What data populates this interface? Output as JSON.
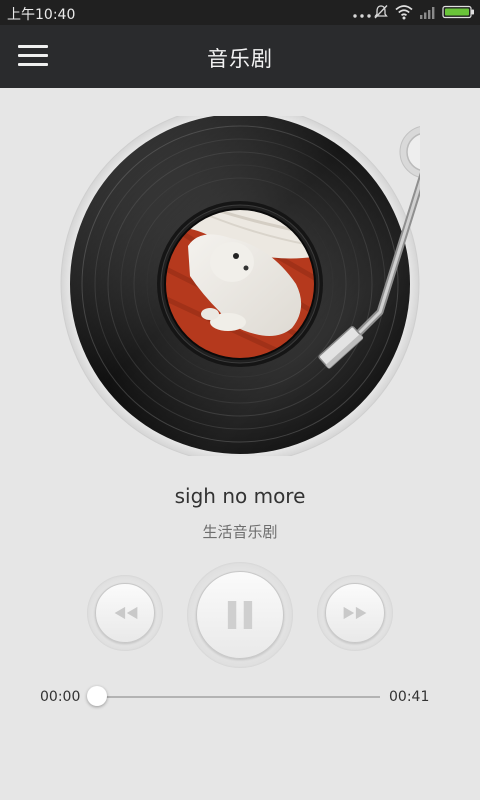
{
  "status_bar": {
    "time": "上午10:40",
    "icons": [
      "more-dots-icon",
      "notifications-muted-icon",
      "wifi-icon",
      "signal-icon",
      "battery-icon"
    ],
    "battery_color": "#6ac43a"
  },
  "app_bar": {
    "title": "音乐剧",
    "menu_icon": "hamburger-menu-icon"
  },
  "player": {
    "song_title": "sigh no more",
    "album": "生活音乐剧",
    "elapsed": "00:00",
    "total": "00:41",
    "progress": 0.0,
    "state": "playing",
    "controls": [
      "rewind-icon",
      "pause-icon",
      "fast-forward-icon"
    ]
  },
  "colors": {
    "app_bar_bg": "#2a2b2d",
    "page_bg": "#e6e6e6",
    "record_label_art": "#b5391d"
  }
}
